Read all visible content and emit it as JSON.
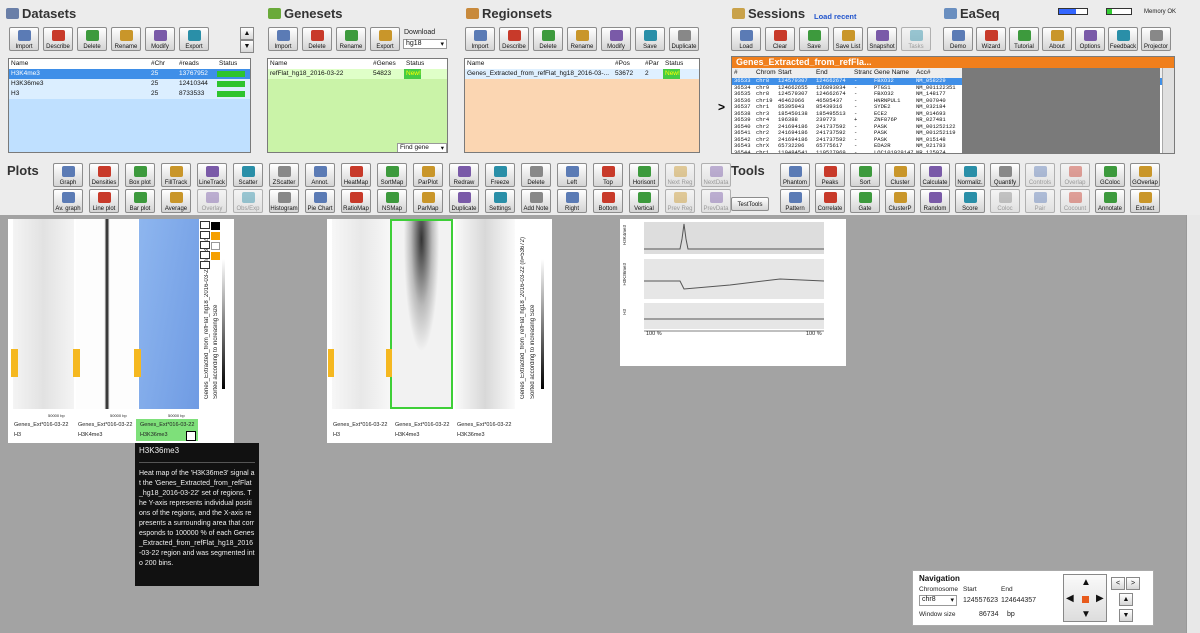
{
  "datasets": {
    "title": "Datasets",
    "buttons": [
      "Import",
      "Describe",
      "Delete",
      "Rename",
      "Modify",
      "Export"
    ],
    "headers": [
      "Name",
      "#Chr",
      "#reads",
      "Status"
    ],
    "rows": [
      {
        "name": "H3K4me3",
        "chr": "25",
        "reads": "13767952"
      },
      {
        "name": "H3K36me3",
        "chr": "25",
        "reads": "12410344"
      },
      {
        "name": "H3",
        "chr": "25",
        "reads": "8733533"
      }
    ]
  },
  "genesets": {
    "title": "Genesets",
    "buttons": [
      "Import",
      "Delete",
      "Rename",
      "Export"
    ],
    "download_label": "Download",
    "download_value": "hg18",
    "headers": [
      "Name",
      "#Genes",
      "Status"
    ],
    "rows": [
      {
        "name": "refFlat_hg18_2016-03-22",
        "genes": "54823",
        "status": "New!"
      }
    ],
    "find_gene": "Find gene"
  },
  "regionsets": {
    "title": "Regionsets",
    "buttons": [
      "Import",
      "Describe",
      "Delete",
      "Rename",
      "Modify",
      "Save",
      "Duplicate"
    ],
    "headers": [
      "Name",
      "#Pos",
      "#Par",
      "Status"
    ],
    "rows": [
      {
        "name": "Genes_Extracted_from_refFlat_hg18_2016-03-...",
        "pos": "53672",
        "par": "2",
        "status": "New!"
      }
    ]
  },
  "sessions": {
    "title": "Sessions",
    "load_recent": "Load recent",
    "buttons": [
      "Load",
      "Clear",
      "Save",
      "Save List",
      "Snapshot",
      "Tasks"
    ]
  },
  "easeq": {
    "title": "EaSeq",
    "buttons": [
      "Demo",
      "Wizard",
      "Tutorial",
      "About",
      "Options",
      "Feedback",
      "Projector"
    ],
    "memory": "Memory OK"
  },
  "region_table": {
    "title": "Genes_Extracted_from_refFla...",
    "arrow": ">",
    "headers": [
      "#",
      "Chromo",
      "Start",
      "End",
      "Strand",
      "Gene Name",
      "Acc#"
    ],
    "rows": [
      [
        "36533",
        "chr8",
        "124579307",
        "124662674",
        "-",
        "FBXO32",
        "NM_058229"
      ],
      [
        "36534",
        "chr9",
        "124662655",
        "126893034",
        "-",
        "PTGS1",
        "NM_001122351"
      ],
      [
        "36535",
        "chr8",
        "124579307",
        "124662674",
        "-",
        "FBXO32",
        "NM_148177"
      ],
      [
        "36536",
        "chr19",
        "46462066",
        "46505437",
        "-",
        "HNRNPUL1",
        "NM_007040"
      ],
      [
        "36537",
        "chr1",
        "85395943",
        "85439316",
        "-",
        "SYDE2",
        "NM_032184"
      ],
      [
        "36538",
        "chr3",
        "185450138",
        "185495513",
        "-",
        "ECE2",
        "NM_014693"
      ],
      [
        "36539",
        "chr4",
        "196388",
        "239773",
        "+",
        "ZNF876P",
        "NR_027481"
      ],
      [
        "36540",
        "chr2",
        "241694186",
        "241737592",
        "-",
        "PASK",
        "NM_001252122"
      ],
      [
        "36541",
        "chr2",
        "241694186",
        "241737592",
        "-",
        "PASK",
        "NM_001252119"
      ],
      [
        "36542",
        "chr2",
        "241694186",
        "241737592",
        "-",
        "PASK",
        "NM_015148"
      ],
      [
        "36543",
        "chrX",
        "65732206",
        "65775617",
        "-",
        "EDA2R",
        "NM_021783"
      ],
      [
        "36544",
        "chr1",
        "119484541",
        "119527969",
        "-",
        "LOC101929147",
        "NR_125974"
      ],
      [
        "36545",
        "chr3",
        "43882734",
        "43926175",
        "+",
        "ABHD5",
        "NM_016006"
      ]
    ]
  },
  "plots": {
    "title": "Plots",
    "row1": [
      "Graph",
      "Densities",
      "Box plot",
      "FillTrack",
      "LineTrack",
      "Scatter",
      "ZScatter",
      "Annot.",
      "HeatMap",
      "SortMap",
      "ParPlot",
      "Redraw",
      "Freeze",
      "Delete",
      "Left",
      "Top",
      "Horisont",
      "Next Reg",
      "NextData"
    ],
    "row2": [
      "Av. graph",
      "Line plot",
      "Bar plot",
      "Average",
      "Overlay",
      "Obs/Exp",
      "Histogram",
      "Pie Chart",
      "RatioMap",
      "NSMap",
      "ParMap",
      "Duplicate",
      "Settings",
      "Add Note",
      "Right",
      "Bottom",
      "Vertical",
      "Prev Reg",
      "PrevData"
    ]
  },
  "tools": {
    "title": "Tools",
    "test": "TestTools",
    "row1": [
      "Phantom",
      "Peaks",
      "Sort",
      "Cluster",
      "Calculate",
      "Normaliz.",
      "Quantify",
      "Controls",
      "Overlap",
      "GColoc",
      "GOverlap"
    ],
    "row2": [
      "Pattern",
      "Correlate",
      "Gate",
      "ClusterP",
      "Random",
      "Score",
      "Coloc",
      "Pair",
      "Cocount",
      "Annotate",
      "Extract"
    ]
  },
  "heatmap_labels": {
    "col1": "Genes_Ext*016-03-22",
    "ds1": "H3",
    "ds2": "H3K4me3",
    "ds3": "H3K36me3",
    "scale": "50000 bp",
    "side": "Genes_Extracted_from_refFlat_hg18_2016-03-22 (n=53672)",
    "sort": "Sorted according to increasing Size"
  },
  "avg_plot": {
    "labels": [
      "H3K4me3",
      "H3K36me3",
      "H3"
    ],
    "x_left": "100 %",
    "x_right": "100 %"
  },
  "tooltip": {
    "title": "H3K36me3",
    "body": "Heat map of the 'H3K36me3' signal at the 'Genes_Extracted_from_refFlat_hg18_2016-03-22' set of regions. The Y-axis represents individual positions of the regions, and the X-axis represents a surrounding area that corresponds to 100000 % of each Genes_Extracted_from_refFlat_hg18_2016-03-22 region and was segmented into 200 bins."
  },
  "navigation": {
    "title": "Navigation",
    "chromosome_label": "Chromosome",
    "start_label": "Start",
    "end_label": "End",
    "chromosome": "chr8",
    "start": "124557623",
    "end": "124644357",
    "window_label": "Window size",
    "window": "86734",
    "window_unit": "bp"
  }
}
